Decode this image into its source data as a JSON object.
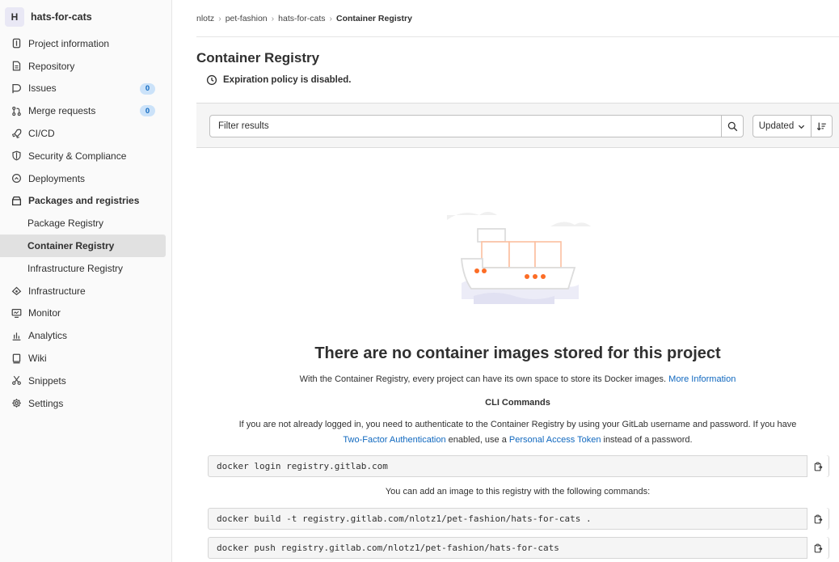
{
  "project": {
    "avatar_letter": "H",
    "name": "hats-for-cats"
  },
  "sidebar": {
    "items": [
      {
        "label": "Project information",
        "icon": "info-icon"
      },
      {
        "label": "Repository",
        "icon": "document-icon"
      },
      {
        "label": "Issues",
        "icon": "issues-icon",
        "badge": "0"
      },
      {
        "label": "Merge requests",
        "icon": "merge-request-icon",
        "badge": "0"
      },
      {
        "label": "CI/CD",
        "icon": "rocket-icon"
      },
      {
        "label": "Security & Compliance",
        "icon": "shield-icon"
      },
      {
        "label": "Deployments",
        "icon": "deployments-icon"
      },
      {
        "label": "Packages and registries",
        "icon": "package-icon"
      },
      {
        "label": "Package Registry"
      },
      {
        "label": "Container Registry"
      },
      {
        "label": "Infrastructure Registry"
      },
      {
        "label": "Infrastructure",
        "icon": "cloud-icon"
      },
      {
        "label": "Monitor",
        "icon": "monitor-icon"
      },
      {
        "label": "Analytics",
        "icon": "chart-icon"
      },
      {
        "label": "Wiki",
        "icon": "book-icon"
      },
      {
        "label": "Snippets",
        "icon": "scissors-icon"
      },
      {
        "label": "Settings",
        "icon": "gear-icon"
      }
    ]
  },
  "breadcrumb": [
    "nlotz",
    "pet-fashion",
    "hats-for-cats",
    "Container Registry"
  ],
  "page": {
    "title": "Container Registry",
    "expiration_notice": "Expiration policy is disabled."
  },
  "filter": {
    "placeholder": "Filter results",
    "sort_label": "Updated"
  },
  "empty_state": {
    "title": "There are no container images stored for this project",
    "description": "With the Container Registry, every project can have its own space to store its Docker images.",
    "more_info_link": "More Information",
    "cli_title": "CLI Commands",
    "cli_desc_part1": "If you are not already logged in, you need to authenticate to the Container Registry by using your GitLab username and password. If you have",
    "two_factor_link": "Two-Factor Authentication",
    "cli_desc_part2": "enabled, use a",
    "pat_link": "Personal Access Token",
    "cli_desc_part3": "instead of a password.",
    "login_command": "docker login registry.gitlab.com",
    "add_image_note": "You can add an image to this registry with the following commands:",
    "build_command": "docker build -t registry.gitlab.com/nlotz1/pet-fashion/hats-for-cats .",
    "push_command": "docker push registry.gitlab.com/nlotz1/pet-fashion/hats-for-cats"
  },
  "colors": {
    "accent_link": "#1068bf",
    "badge_bg": "#cbe2f9",
    "active_item_bg": "#e1e1e1",
    "illustration_orange": "#fc6d26"
  }
}
